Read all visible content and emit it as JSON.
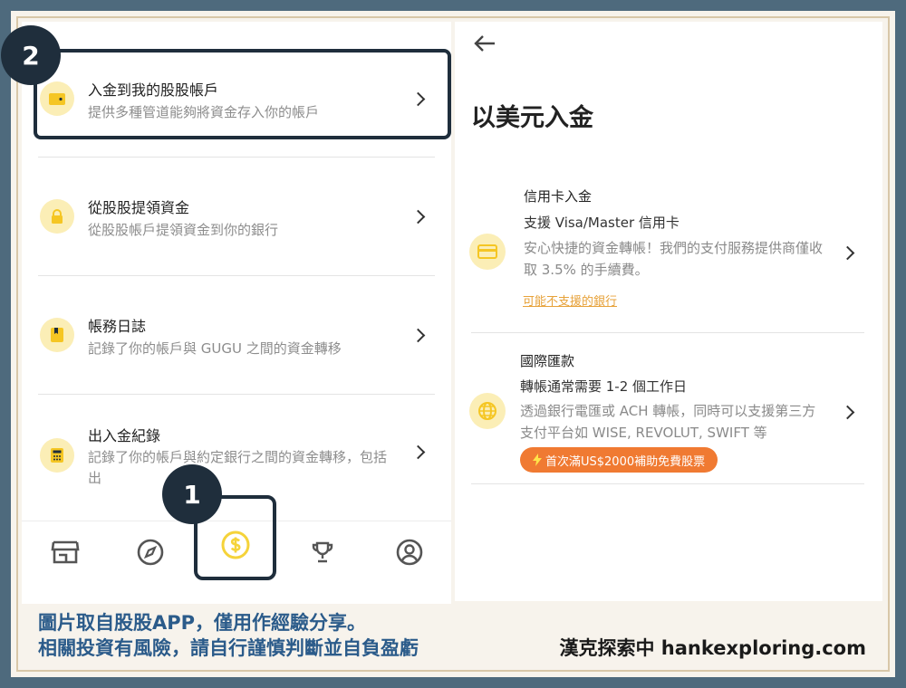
{
  "left": {
    "items": [
      {
        "title": "入金到我的股股帳戶",
        "subtitle": "提供多種管道能夠將資金存入你的帳戶",
        "icon": "wallet-icon"
      },
      {
        "title": "從股股提領資金",
        "subtitle": "從股股帳戶提領資金到你的銀行",
        "icon": "lock-icon"
      },
      {
        "title": "帳務日誌",
        "subtitle": "記錄了你的帳戶與 GUGU 之間的資金轉移",
        "icon": "bookmark-icon"
      },
      {
        "title": "出入金紀錄",
        "subtitle": "記錄了你的帳戶與約定銀行之間的資金轉移，包括出",
        "icon": "calculator-icon"
      }
    ],
    "badges": {
      "one": "1",
      "two": "2"
    },
    "tabs": [
      "store-icon",
      "compass-icon",
      "dollar-icon",
      "trophy-icon",
      "profile-icon"
    ]
  },
  "right": {
    "title": "以美元入金",
    "options": [
      {
        "title": "信用卡入金",
        "subtitle": "支援 Visa/Master 信用卡",
        "desc": "安心快捷的資金轉帳！我們的支付服務提供商僅收取 3.5% 的手續費。",
        "link": "可能不支援的銀行",
        "icon": "card-icon"
      },
      {
        "title": "國際匯款",
        "subtitle": "轉帳通常需要 1-2 個工作日",
        "desc": "透過銀行電匯或 ACH 轉帳，同時可以支援第三方支付平台如 WISE, REVOLUT, SWIFT 等",
        "promo": "首次滿US$2000補助免費股票",
        "icon": "globe-icon"
      }
    ]
  },
  "caption": {
    "line1": "圖片取自股股APP，僅用作經驗分享。",
    "line2": "相關投資有風險，請自行謹慎判斷並自負盈虧",
    "brand": "漢克探索中 hankexploring.com"
  },
  "colors": {
    "accent": "#f5d33a",
    "dark": "#1f2e3c",
    "promo": "#f07a32",
    "caption": "#2b5b8a"
  }
}
